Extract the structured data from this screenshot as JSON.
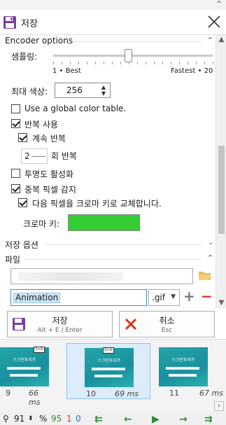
{
  "window": {
    "title": "저장",
    "title_icon": "floppy-disk-icon",
    "close_icon": "close-icon"
  },
  "encoder": {
    "section_label": "Encoder options",
    "sampling_label": "샘플링:",
    "sampling_min_label": "1 • Best",
    "sampling_max_label": "Fastest • 20",
    "sampling_value_fraction": 0.47,
    "max_colors_label": "최대 색상:",
    "max_colors_value": "256",
    "global_color_table_label": "Use a global color table.",
    "global_color_table_checked": false,
    "repeat_label": "반복 사용",
    "repeat_checked": true,
    "loop_forever_label": "계속 반복",
    "loop_forever_checked": true,
    "repeat_count_value": "2",
    "repeat_count_suffix": "회 반복",
    "transparency_label": "투명도 활성화",
    "transparency_checked": false,
    "detect_unchanged_label": "중복 픽셀 감지",
    "detect_unchanged_checked": true,
    "replace_chroma_label": "다음 픽셀을 크로마 키로 교체합니다.",
    "replace_chroma_checked": true,
    "chroma_key_label": "크로마 키:",
    "chroma_key_color": "#33cc33"
  },
  "save_options": {
    "section_label": "저장 옵션"
  },
  "file": {
    "section_label": "파일",
    "path_value": "",
    "folder_icon": "folder-icon",
    "file_name": "Animation",
    "extension": ".gif",
    "add_icon": "plus-icon",
    "remove_icon": "minus-icon"
  },
  "buttons": {
    "save_label": "저장",
    "save_shortcut": "Alt + E / Enter",
    "cancel_label": "취소",
    "cancel_shortcut": "Esc"
  },
  "frames": [
    {
      "index": "9",
      "duration": "66 ms",
      "caption": "스크린투지프"
    },
    {
      "index": "10",
      "duration": "69 ms",
      "caption": "스크린투지프"
    },
    {
      "index": "11",
      "duration": "67 ms",
      "caption": "스크린투지프"
    }
  ],
  "status": {
    "zoom_value": "91",
    "zoom_unit": "%",
    "frame_count": "95",
    "selected_count": "1",
    "current_count": "0"
  },
  "colors": {
    "accent": "#3c8bd9",
    "selection": "#cce4f7",
    "nav_green": "#2f8a3d",
    "danger": "#d9341a"
  }
}
